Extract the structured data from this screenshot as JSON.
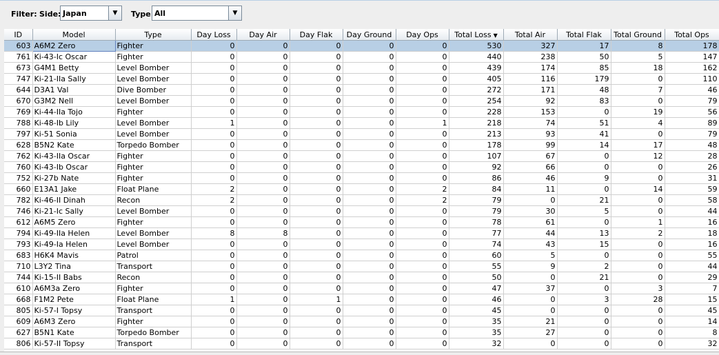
{
  "filter": {
    "label": "Filter:",
    "side_label": "Side:",
    "side_value": "Japan",
    "type_label": "Type:",
    "type_value": "All",
    "dropdown_glyph": "▼"
  },
  "table": {
    "sort_glyph": "▼",
    "columns": [
      "ID",
      "Model",
      "Type",
      "Day Loss",
      "Day Air",
      "Day Flak",
      "Day Ground",
      "Day Ops",
      "Total Loss",
      "Total Air",
      "Total Flak",
      "Total Ground",
      "Total Ops"
    ],
    "rows": [
      [
        "603",
        "A6M2 Zero",
        "Fighter",
        "0",
        "0",
        "0",
        "0",
        "0",
        "530",
        "327",
        "17",
        "8",
        "178"
      ],
      [
        "761",
        "Ki-43-Ic Oscar",
        "Fighter",
        "0",
        "0",
        "0",
        "0",
        "0",
        "440",
        "238",
        "50",
        "5",
        "147"
      ],
      [
        "673",
        "G4M1 Betty",
        "Level Bomber",
        "0",
        "0",
        "0",
        "0",
        "0",
        "439",
        "174",
        "85",
        "18",
        "162"
      ],
      [
        "747",
        "Ki-21-IIa Sally",
        "Level Bomber",
        "0",
        "0",
        "0",
        "0",
        "0",
        "405",
        "116",
        "179",
        "0",
        "110"
      ],
      [
        "644",
        "D3A1 Val",
        "Dive Bomber",
        "0",
        "0",
        "0",
        "0",
        "0",
        "272",
        "171",
        "48",
        "7",
        "46"
      ],
      [
        "670",
        "G3M2 Nell",
        "Level Bomber",
        "0",
        "0",
        "0",
        "0",
        "0",
        "254",
        "92",
        "83",
        "0",
        "79"
      ],
      [
        "769",
        "Ki-44-IIa Tojo",
        "Fighter",
        "0",
        "0",
        "0",
        "0",
        "0",
        "228",
        "153",
        "0",
        "19",
        "56"
      ],
      [
        "788",
        "Ki-48-Ib Lily",
        "Level Bomber",
        "1",
        "0",
        "0",
        "0",
        "1",
        "218",
        "74",
        "51",
        "4",
        "89"
      ],
      [
        "797",
        "Ki-51 Sonia",
        "Level Bomber",
        "0",
        "0",
        "0",
        "0",
        "0",
        "213",
        "93",
        "41",
        "0",
        "79"
      ],
      [
        "628",
        "B5N2 Kate",
        "Torpedo Bomber",
        "0",
        "0",
        "0",
        "0",
        "0",
        "178",
        "99",
        "14",
        "17",
        "48"
      ],
      [
        "762",
        "Ki-43-IIa Oscar",
        "Fighter",
        "0",
        "0",
        "0",
        "0",
        "0",
        "107",
        "67",
        "0",
        "12",
        "28"
      ],
      [
        "760",
        "Ki-43-Ib Oscar",
        "Fighter",
        "0",
        "0",
        "0",
        "0",
        "0",
        "92",
        "66",
        "0",
        "0",
        "26"
      ],
      [
        "752",
        "Ki-27b Nate",
        "Fighter",
        "0",
        "0",
        "0",
        "0",
        "0",
        "86",
        "46",
        "9",
        "0",
        "31"
      ],
      [
        "660",
        "E13A1 Jake",
        "Float Plane",
        "2",
        "0",
        "0",
        "0",
        "2",
        "84",
        "11",
        "0",
        "14",
        "59"
      ],
      [
        "782",
        "Ki-46-II Dinah",
        "Recon",
        "2",
        "0",
        "0",
        "0",
        "2",
        "79",
        "0",
        "21",
        "0",
        "58"
      ],
      [
        "746",
        "Ki-21-Ic Sally",
        "Level Bomber",
        "0",
        "0",
        "0",
        "0",
        "0",
        "79",
        "30",
        "5",
        "0",
        "44"
      ],
      [
        "612",
        "A6M5 Zero",
        "Fighter",
        "0",
        "0",
        "0",
        "0",
        "0",
        "78",
        "61",
        "0",
        "1",
        "16"
      ],
      [
        "794",
        "Ki-49-IIa Helen",
        "Level Bomber",
        "8",
        "8",
        "0",
        "0",
        "0",
        "77",
        "44",
        "13",
        "2",
        "18"
      ],
      [
        "793",
        "Ki-49-Ia Helen",
        "Level Bomber",
        "0",
        "0",
        "0",
        "0",
        "0",
        "74",
        "43",
        "15",
        "0",
        "16"
      ],
      [
        "683",
        "H6K4 Mavis",
        "Patrol",
        "0",
        "0",
        "0",
        "0",
        "0",
        "60",
        "5",
        "0",
        "0",
        "55"
      ],
      [
        "710",
        "L3Y2 Tina",
        "Transport",
        "0",
        "0",
        "0",
        "0",
        "0",
        "55",
        "9",
        "2",
        "0",
        "44"
      ],
      [
        "744",
        "Ki-15-II Babs",
        "Recon",
        "0",
        "0",
        "0",
        "0",
        "0",
        "50",
        "0",
        "21",
        "0",
        "29"
      ],
      [
        "610",
        "A6M3a Zero",
        "Fighter",
        "0",
        "0",
        "0",
        "0",
        "0",
        "47",
        "37",
        "0",
        "3",
        "7"
      ],
      [
        "668",
        "F1M2 Pete",
        "Float Plane",
        "1",
        "0",
        "1",
        "0",
        "0",
        "46",
        "0",
        "3",
        "28",
        "15"
      ],
      [
        "805",
        "Ki-57-I Topsy",
        "Transport",
        "0",
        "0",
        "0",
        "0",
        "0",
        "45",
        "0",
        "0",
        "0",
        "45"
      ],
      [
        "609",
        "A6M3 Zero",
        "Fighter",
        "0",
        "0",
        "0",
        "0",
        "0",
        "35",
        "21",
        "0",
        "0",
        "14"
      ],
      [
        "627",
        "B5N1 Kate",
        "Torpedo Bomber",
        "0",
        "0",
        "0",
        "0",
        "0",
        "35",
        "27",
        "0",
        "0",
        "8"
      ],
      [
        "806",
        "Ki-57-II Topsy",
        "Transport",
        "0",
        "0",
        "0",
        "0",
        "0",
        "32",
        "0",
        "0",
        "0",
        "32"
      ]
    ]
  }
}
